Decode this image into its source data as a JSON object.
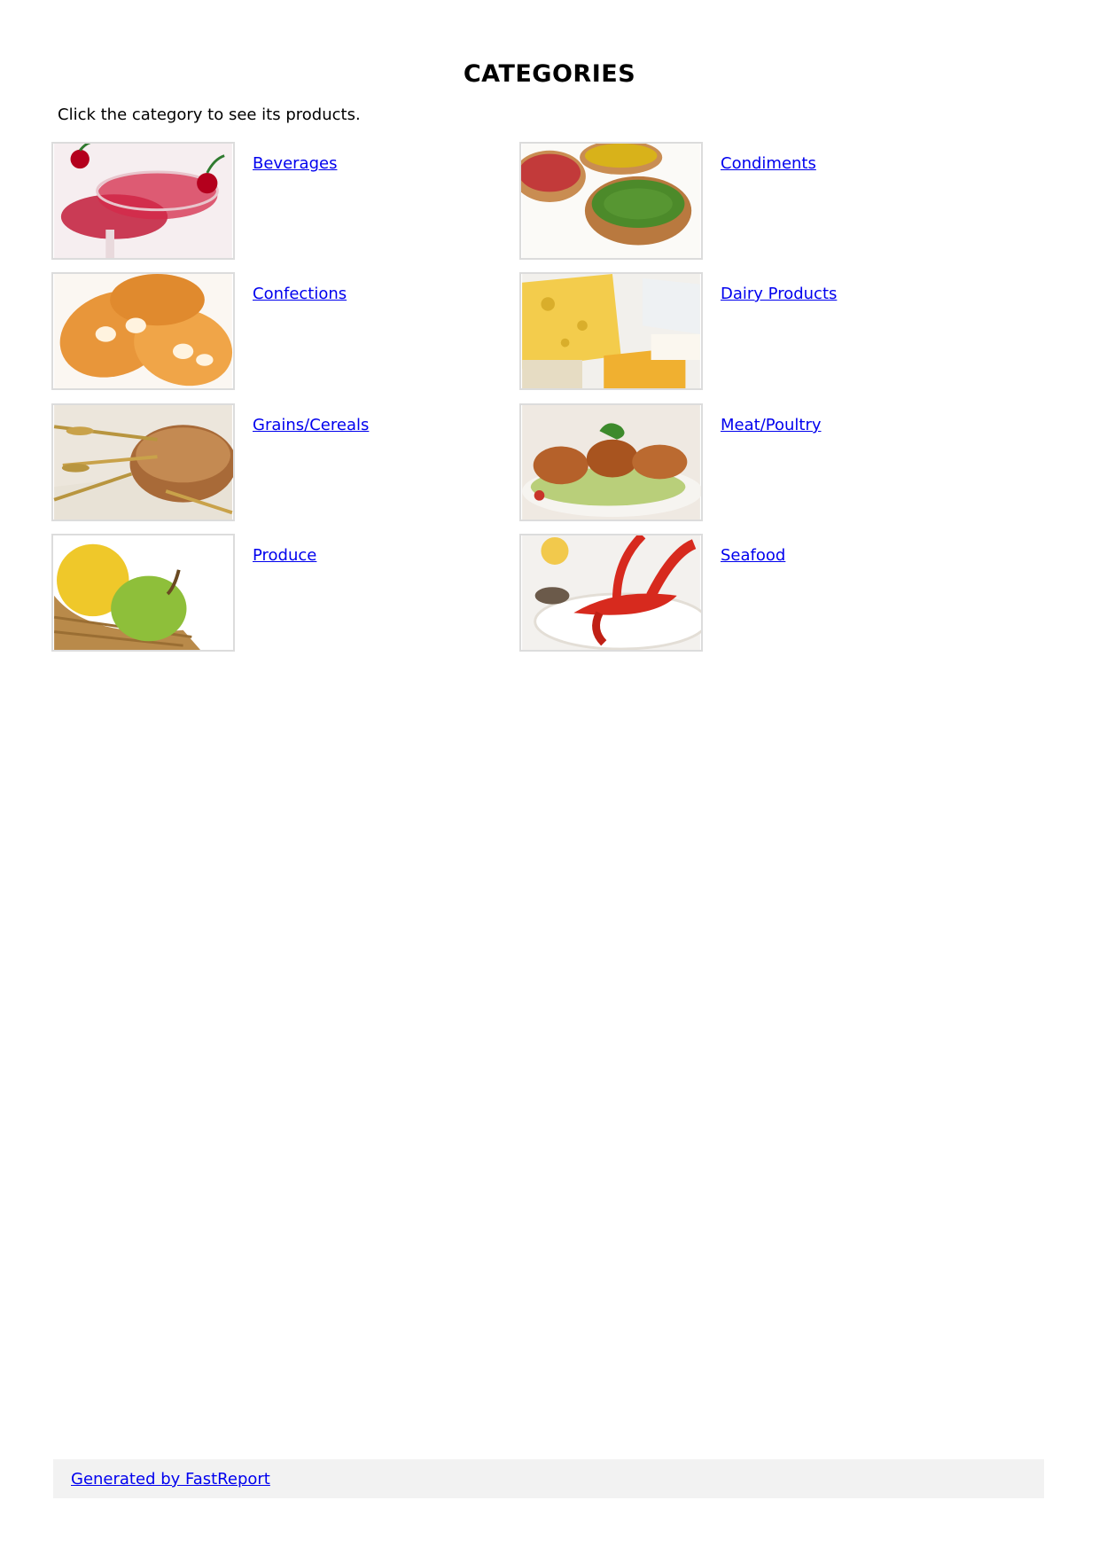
{
  "page": {
    "title": "CATEGORIES",
    "intro": "Click the category to see its products."
  },
  "categories": [
    {
      "label": "Beverages",
      "icon": "beverages-image"
    },
    {
      "label": "Condiments",
      "icon": "condiments-image"
    },
    {
      "label": "Confections",
      "icon": "confections-image"
    },
    {
      "label": "Dairy Products",
      "icon": "dairy-products-image"
    },
    {
      "label": "Grains/Cereals",
      "icon": "grains-cereals-image"
    },
    {
      "label": "Meat/Poultry",
      "icon": "meat-poultry-image"
    },
    {
      "label": "Produce",
      "icon": "produce-image"
    },
    {
      "label": "Seafood",
      "icon": "seafood-image"
    }
  ],
  "footer": {
    "link_label": "Generated by FastReport"
  },
  "colors": {
    "link": "#0000ee",
    "thumb_border": "#dcdcdc",
    "footer_bg": "#f2f2f2"
  }
}
